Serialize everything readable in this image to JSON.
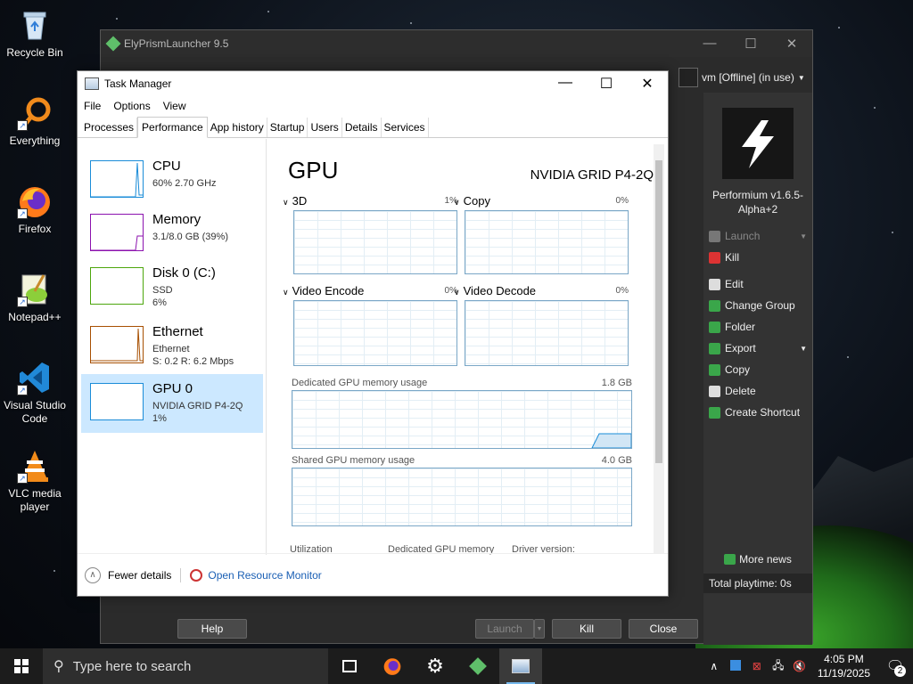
{
  "desktop": {
    "icons": [
      {
        "label": "Recycle Bin"
      },
      {
        "label": "Everything"
      },
      {
        "label": "Firefox"
      },
      {
        "label": "Notepad++"
      },
      {
        "label": "Visual Studio Code"
      },
      {
        "label": "VLC media player"
      }
    ]
  },
  "prism": {
    "title": "ElyPrismLauncher 9.5",
    "account": "vm [Offline] (in use)",
    "instance_name": "Performium v1.6.5-Alpha+2",
    "actions": [
      {
        "label": "Launch",
        "disabled": true
      },
      {
        "label": "Kill",
        "disabled": false
      },
      {
        "label": "Edit",
        "disabled": false
      },
      {
        "label": "Change Group",
        "disabled": false
      },
      {
        "label": "Folder",
        "disabled": false
      },
      {
        "label": "Export",
        "disabled": false
      },
      {
        "label": "Copy",
        "disabled": false
      },
      {
        "label": "Delete",
        "disabled": false
      },
      {
        "label": "Create Shortcut",
        "disabled": false
      }
    ],
    "more_news": "More news",
    "total_playtime": "Total playtime: 0s",
    "buttons": {
      "help": "Help",
      "launch": "Launch",
      "kill": "Kill",
      "close": "Close"
    }
  },
  "taskmanager": {
    "title": "Task Manager",
    "menu": [
      "File",
      "Options",
      "View"
    ],
    "tabs": [
      "Processes",
      "Performance",
      "App history",
      "Startup",
      "Users",
      "Details",
      "Services"
    ],
    "active_tab": "Performance",
    "resources": [
      {
        "name": "CPU",
        "line2": "60%  2.70 GHz",
        "line3": "",
        "color": "#1a8cd8"
      },
      {
        "name": "Memory",
        "line2": "3.1/8.0 GB (39%)",
        "line3": "",
        "color": "#8b12ae"
      },
      {
        "name": "Disk 0 (C:)",
        "line2": "SSD",
        "line3": "6%",
        "color": "#4da60c"
      },
      {
        "name": "Ethernet",
        "line2": "Ethernet",
        "line3": "S: 0.2  R: 6.2 Mbps",
        "color": "#a74f01"
      },
      {
        "name": "GPU 0",
        "line2": "NVIDIA GRID P4-2Q",
        "line3": "1%",
        "color": "#1a8cd8"
      }
    ],
    "selected_resource": "GPU 0",
    "gpu": {
      "heading": "GPU",
      "model": "NVIDIA GRID P4-2Q",
      "engines": [
        {
          "name": "3D",
          "percent": "1%"
        },
        {
          "name": "Copy",
          "percent": "0%"
        },
        {
          "name": "Video Encode",
          "percent": "0%"
        },
        {
          "name": "Video Decode",
          "percent": "0%"
        }
      ],
      "dedicated_label": "Dedicated GPU memory usage",
      "dedicated_max": "1.8 GB",
      "shared_label": "Shared GPU memory usage",
      "shared_max": "4.0 GB",
      "footer_labels": [
        "Utilization",
        "Dedicated GPU memory",
        "Driver version:"
      ]
    },
    "footer": {
      "fewer": "Fewer details",
      "monitor": "Open Resource Monitor"
    }
  },
  "taskbar": {
    "search_placeholder": "Type here to search",
    "time": "4:05 PM",
    "date": "11/19/2025",
    "notification_count": "2"
  },
  "colors": {
    "accent": "#1a8cd8",
    "selection": "#cce8ff",
    "taskbar": "#1c1c1c"
  }
}
